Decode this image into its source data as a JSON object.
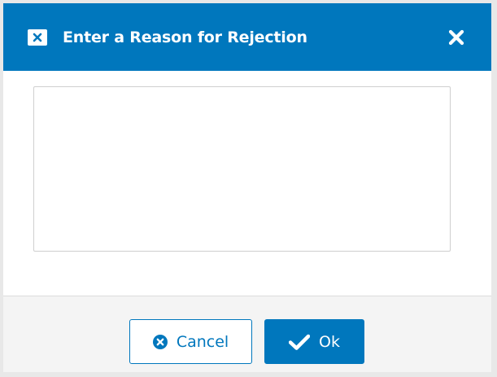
{
  "dialog": {
    "title": "Enter a Reason for Rejection",
    "header_icon": "close-box-icon",
    "close_icon": "close-icon"
  },
  "reason_field": {
    "value": "",
    "placeholder": ""
  },
  "buttons": {
    "cancel_label": "Cancel",
    "cancel_icon": "times-circle-icon",
    "ok_label": "Ok",
    "ok_icon": "checkmark-icon"
  },
  "colors": {
    "accent": "#0077bd",
    "background": "#ffffff",
    "footer": "#f4f4f4"
  }
}
